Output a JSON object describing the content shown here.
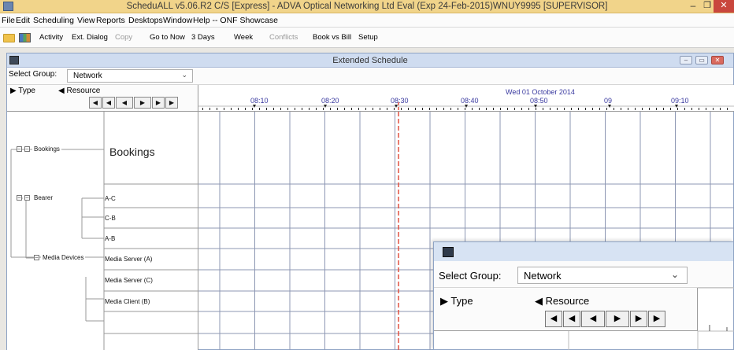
{
  "window": {
    "title": "ScheduALL v5.06.R2 C/S [Express] - ADVA Optical Networking Ltd Eval (Exp 24-Feb-2015)WNUY9995 [SUPERVISOR]",
    "min": "–",
    "max": "❐",
    "close": "✕"
  },
  "menu": [
    "File",
    "Edit",
    "Scheduling",
    "View",
    "Reports",
    "Desktops",
    "Window",
    "Help -- ONF Showcase"
  ],
  "toolbar": {
    "activity": "Activity",
    "ext_dialog": "Ext. Dialog",
    "copy": "Copy",
    "go_to_now": "Go to Now",
    "three_days": "3 Days",
    "week": "Week",
    "conflicts": "Conflicts",
    "book_vs_bill": "Book vs Bill",
    "setup": "Setup"
  },
  "schedule": {
    "title": "Extended Schedule",
    "select_group_label": "Select Group:",
    "select_group_value": "Network",
    "type_label": "Type",
    "resource_label": "Resource",
    "date": "Wed 01 October 2014",
    "time_labels": [
      "08:10",
      "08:20",
      "08:30",
      "08:40",
      "08:50",
      "09",
      "09:10"
    ],
    "tree": {
      "bookings": "Bookings",
      "bearer": "Bearer",
      "media_devices": "Media Devices"
    },
    "bookings_big": "Bookings",
    "resources": [
      "A-C",
      "C-B",
      "A-B",
      "Media Server (A)",
      "Media Server (C)",
      "Media Client (B)"
    ]
  },
  "overlay": {
    "select_group_label": "Select Group:",
    "select_group_value": "Network",
    "type_label": "Type",
    "resource_label": "Resource"
  },
  "colors": {
    "title_bar": "#f1d48a",
    "now_line": "#e05040",
    "grid_line": "#8d97b3",
    "time_label": "#3a3aa0"
  }
}
